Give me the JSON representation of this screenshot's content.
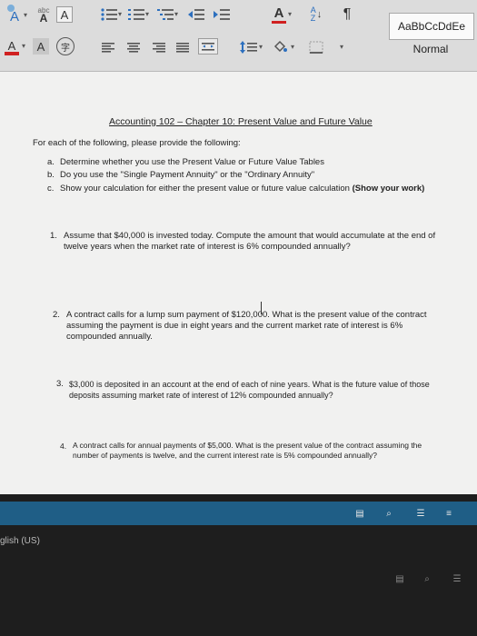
{
  "ribbon": {
    "row1": {
      "text_effects_glyph": "A",
      "abc_glyph": "abc",
      "abc_sub_glyph": "A",
      "boxed_a_glyph": "A",
      "font_color_glyph": "A",
      "sort_glyph": "A",
      "sort_glyph2": "Z",
      "pilcrow_glyph": "¶"
    },
    "row2": {
      "highlight_glyph": "A",
      "shade_glyph": "A",
      "phonetic_glyph": "字"
    },
    "styles": {
      "preview": "AaBbCcDdEe",
      "normal": "Normal"
    }
  },
  "document": {
    "title": "Accounting 102 – Chapter 10: Present Value and Future Value",
    "instruction": "For each of the following, please provide the following:",
    "list": [
      {
        "marker": "a.",
        "text": "Determine whether you use the Present Value or Future Value Tables"
      },
      {
        "marker": "b.",
        "text": "Do you use the \"Single Payment Annuity\" or the \"Ordinary Annuity\""
      },
      {
        "marker": "c.",
        "text": "Show your calculation for either the present value or future value calculation",
        "bold": "(Show your work)"
      }
    ],
    "questions": [
      {
        "number": "1.",
        "text": "Assume that $40,000 is invested today. Compute the amount that would accumulate at the end of twelve years when the market rate of interest is 6% compounded annually?"
      },
      {
        "number": "2.",
        "text": "A contract calls for a lump sum payment of $120,000. What is the present value of the contract assuming the payment is due in eight years and the current market rate of interest is 6% compounded annually."
      },
      {
        "number": "3.",
        "text": "$3,000 is deposited in an account at the end of each of nine years. What is the future value of those deposits assuming market rate of interest of 12% compounded annually?"
      },
      {
        "number": "4.",
        "text": "A contract calls for annual payments of $5,000. What is the present value of the contract assuming the number of payments is twelve, and the current interest rate is 5% compounded annually?"
      }
    ]
  },
  "statusbar": {
    "language": "glish (US)"
  },
  "colors": {
    "ribbon_bg": "#dcdcdc",
    "doc_bg": "#f1f1f0",
    "status_bar": "#1f5e86",
    "font_color_red": "#d02020"
  }
}
